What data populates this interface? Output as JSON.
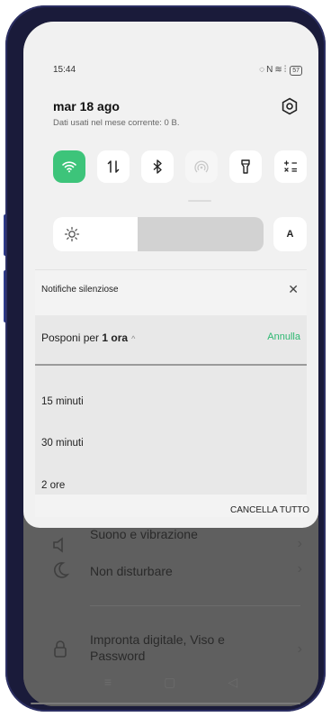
{
  "status_bar": {
    "time": "15:44",
    "battery": "57"
  },
  "header": {
    "date": "mar 18 ago",
    "data_usage": "Dati usati nel mese corrente: 0 B."
  },
  "quick_settings": {
    "tiles": [
      {
        "name": "wifi",
        "icon": "wifi-icon",
        "active": true
      },
      {
        "name": "mobile-data",
        "icon": "mobile-data-icon",
        "active": false
      },
      {
        "name": "bluetooth",
        "icon": "bluetooth-icon",
        "active": false
      },
      {
        "name": "hotspot",
        "icon": "hotspot-icon",
        "active": false,
        "disabled": true
      },
      {
        "name": "flashlight",
        "icon": "flashlight-icon",
        "active": false
      },
      {
        "name": "calculator",
        "icon": "calculator-icon",
        "active": false
      }
    ],
    "brightness_level": 0.4,
    "auto_brightness_label": "A"
  },
  "notification": {
    "title": "Notifiche silenziose",
    "snooze_prefix": "Posponi per ",
    "snooze_value": "1 ora",
    "cancel_label": "Annulla",
    "options": [
      "15 minuti",
      "30 minuti",
      "2 ore"
    ],
    "clear_all_label": "CANCELLA TUTTO"
  },
  "background_settings": {
    "items": [
      {
        "label": "Suono e vibrazione",
        "icon": "sound-icon"
      },
      {
        "label": "Non disturbare",
        "icon": "moon-icon"
      },
      {
        "label_line1": "Impronta digitale, Viso e",
        "label_line2": "Password",
        "icon": "lock-icon"
      }
    ]
  },
  "colors": {
    "accent": "#3dc47a",
    "annulla": "#2eb872"
  }
}
